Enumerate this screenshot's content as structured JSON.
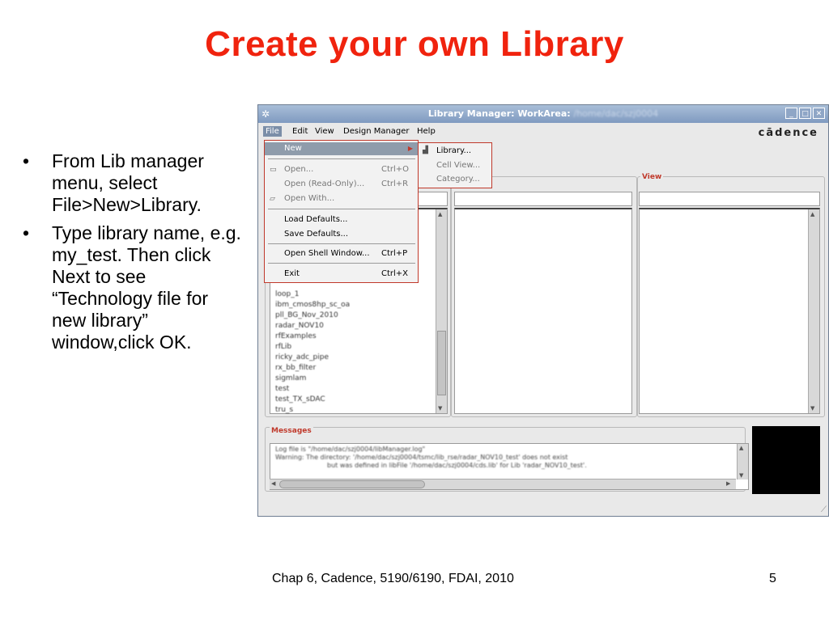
{
  "slide": {
    "title": "Create your own Library",
    "bullets": [
      "From Lib manager menu, select File>New>Library.",
      "Type library name, e.g. my_test. Then click Next to see “Technology file for new library” window,click OK."
    ],
    "footer": "Chap 6, Cadence, 5190/6190, FDAI, 2010",
    "page_number": "5"
  },
  "window": {
    "title": "Library Manager: WorkArea:",
    "title_path": "/home/dac/szj0004",
    "brand": "cādence",
    "menu": [
      "File",
      "Edit",
      "View",
      "Design Manager",
      "Help"
    ],
    "view_label": "View",
    "messages_label": "Messages"
  },
  "file_menu": {
    "items": [
      {
        "label": "New",
        "shortcut": "",
        "state": "highlighted",
        "submenu": true
      },
      {
        "label": "Open...",
        "shortcut": "Ctrl+O",
        "state": "disabled",
        "icon": "folder-icon"
      },
      {
        "label": "Open (Read-Only)...",
        "shortcut": "Ctrl+R",
        "state": "disabled"
      },
      {
        "label": "Open With...",
        "shortcut": "",
        "state": "disabled",
        "icon": "folder-open-icon"
      },
      {
        "label": "Load Defaults...",
        "shortcut": "",
        "state": "enabled"
      },
      {
        "label": "Save Defaults...",
        "shortcut": "",
        "state": "enabled"
      },
      {
        "label": "Open Shell Window...",
        "shortcut": "Ctrl+P",
        "state": "enabled"
      },
      {
        "label": "Exit",
        "shortcut": "Ctrl+X",
        "state": "enabled"
      }
    ]
  },
  "new_submenu": {
    "items": [
      {
        "label": "Library...",
        "state": "enabled",
        "icon": "library-icon"
      },
      {
        "label": "Cell View...",
        "state": "disabled"
      },
      {
        "label": "Category...",
        "state": "disabled"
      }
    ]
  },
  "library_list": [
    "loop_1",
    "ibm_cmos8hp_sc_oa",
    "pll_BG_Nov_2010",
    "radar_NOV10",
    "rfExamples",
    "rfLib",
    "ricky_adc_pipe",
    "rx_bb_filter",
    "sigmlam",
    "test",
    "test_TX_sDAC",
    "tru_s"
  ],
  "messages": [
    "Log file is \"/home/dac/szj0004/libManager.log\"",
    "Warning: The directory: '/home/dac/szj0004/tsmc/lib_rse/radar_NOV10_test' does not exist",
    "but was defined in libFile '/home/dac/szj0004/cds.lib' for Lib 'radar_NOV10_test'."
  ],
  "colors": {
    "title_red": "#f0230e",
    "menu_highlight": "#8f9cab",
    "titlebar": "#8aa3c6"
  }
}
